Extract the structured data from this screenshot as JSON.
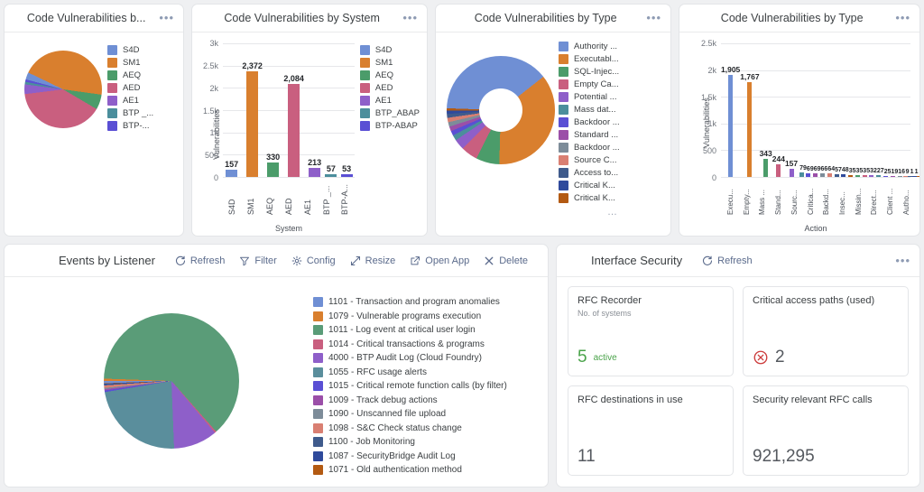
{
  "cards": {
    "c1": {
      "title": "Code Vulnerabilities b...",
      "kebab": "•••"
    },
    "c2": {
      "title": "Code Vulnerabilities by System",
      "kebab": "•••"
    },
    "c3": {
      "title": "Code Vulnerabilities by Type",
      "kebab": "•••",
      "more": "…"
    },
    "c4": {
      "title": "Code Vulnerabilities by Type",
      "kebab": "•••"
    },
    "events": {
      "title": "Events by Listener",
      "tools": [
        {
          "label": "Refresh",
          "icon": "refresh-icon"
        },
        {
          "label": "Filter",
          "icon": "filter-icon"
        },
        {
          "label": "Config",
          "icon": "gear-icon"
        },
        {
          "label": "Resize",
          "icon": "resize-icon"
        },
        {
          "label": "Open App",
          "icon": "open-app-icon"
        },
        {
          "label": "Delete",
          "icon": "close-icon"
        }
      ],
      "more": "…"
    },
    "interface_security": {
      "title": "Interface Security",
      "refresh_label": "Refresh",
      "kebab": "•••"
    }
  },
  "chart_data": [
    {
      "id": "code_vuln_by_system_pie",
      "type": "pie",
      "title": "Code Vulnerabilities b...",
      "categories": [
        "S4D",
        "SM1",
        "AEQ",
        "AED",
        "AE1",
        "BTP _...",
        "BTP-..."
      ],
      "values": [
        157,
        2372,
        330,
        2084,
        213,
        57,
        53
      ],
      "colors": [
        "#6f8fd4",
        "#d97f2e",
        "#4b9c6a",
        "#c95f7f",
        "#8e5fc9",
        "#4b8e9c",
        "#5a4fd4"
      ],
      "legend_labels": [
        "S4D",
        "SM1",
        "AEQ",
        "AED",
        "AE1",
        "BTP _...",
        "BTP-..."
      ],
      "legend_position": "right"
    },
    {
      "id": "code_vuln_by_system_bar",
      "type": "bar",
      "title": "Code Vulnerabilities by System",
      "xlabel": "System",
      "ylabel": "Vulnerabilities",
      "categories": [
        "S4D",
        "SM1",
        "AEQ",
        "AED",
        "AE1",
        "BTP _...",
        "BTP-A..."
      ],
      "values": [
        157,
        2372,
        330,
        2084,
        213,
        57,
        53
      ],
      "value_labels": [
        "157",
        "2,372",
        "330",
        "2,084",
        "213",
        "57",
        "53"
      ],
      "colors": [
        "#6f8fd4",
        "#d97f2e",
        "#4b9c6a",
        "#c95f7f",
        "#8e5fc9",
        "#4b8e9c",
        "#5a4fd4"
      ],
      "ylim": [
        0,
        3000
      ],
      "yticks": [
        0,
        500,
        1000,
        1500,
        2000,
        2500,
        3000
      ],
      "ytick_labels": [
        "0",
        "500",
        "1k",
        "1.5k",
        "2k",
        "2.5k",
        "3k"
      ],
      "grid": true,
      "legend_labels": [
        "S4D",
        "SM1",
        "AEQ",
        "AED",
        "AE1",
        "BTP_ABAP",
        "BTP-ABAP"
      ],
      "legend_position": "right"
    },
    {
      "id": "code_vuln_by_type_donut",
      "type": "pie",
      "title": "Code Vulnerabilities by Type",
      "categories": [
        "Authority ...",
        "Executabl...",
        "SQL-Injec...",
        "Empty Ca...",
        "Potential ...",
        "Mass dat...",
        "Backdoor ...",
        "Standard ...",
        "Backdoor ...",
        "Source C...",
        "Access to...",
        "Critical K...",
        "Critical K..."
      ],
      "values": [
        1905,
        1767,
        343,
        244,
        157,
        79,
        69,
        69,
        66,
        64,
        57,
        48,
        35
      ],
      "colors": [
        "#6f8fd4",
        "#d97f2e",
        "#4b9c6a",
        "#c95f7f",
        "#8e5fc9",
        "#4b8e9c",
        "#5a4fd4",
        "#9b4fa8",
        "#7d8c99",
        "#d97f72",
        "#3f5b8c",
        "#2f4a9c",
        "#b35a12"
      ],
      "legend_labels": [
        "Authority ...",
        "Executabl...",
        "SQL-Injec...",
        "Empty Ca...",
        "Potential ...",
        "Mass dat...",
        "Backdoor ...",
        "Standard ...",
        "Backdoor ...",
        "Source C...",
        "Access to...",
        "Critical K...",
        "Critical K..."
      ],
      "legend_position": "right"
    },
    {
      "id": "code_vuln_by_type_bar",
      "type": "bar",
      "title": "Code Vulnerabilities by Type",
      "xlabel": "Action",
      "ylabel": "Vulnerabilities",
      "categories": [
        "Execu...",
        "Empty...",
        "Mass ...",
        "Stand...",
        "Sourc...",
        "Critica...",
        "Backd...",
        "Insec...",
        "Missin...",
        "Direct...",
        "Client ...",
        "Autho..."
      ],
      "values": [
        1905,
        1767,
        343,
        244,
        157,
        79,
        69,
        69,
        66,
        64,
        57,
        48,
        35,
        35,
        35,
        32,
        27,
        25,
        19,
        16,
        9,
        1,
        1,
        1
      ],
      "value_labels": [
        "1,905",
        "1,767",
        "343",
        "244",
        "157",
        "79",
        "69",
        "69",
        "66",
        "64",
        "57",
        "48",
        "35",
        "35",
        "35",
        "32",
        "27",
        "25",
        "19",
        "16",
        "9",
        "1",
        "1",
        "1"
      ],
      "colors": [
        "#6f8fd4",
        "#d97f2e",
        "#4b9c6a",
        "#c95f7f",
        "#8e5fc9",
        "#4b8e9c",
        "#5a4fd4",
        "#9b4fa8",
        "#7d8c99",
        "#d97f72",
        "#3f5b8c",
        "#2f4a9c",
        "#b35a12",
        "#4b9c6a",
        "#c95f7f",
        "#8e5fc9",
        "#4b8e9c",
        "#5a4fd4",
        "#9b4fa8",
        "#7d8c99",
        "#d97f72",
        "#3f5b8c",
        "#2f4a9c",
        "#b35a12"
      ],
      "ylim": [
        0,
        2500
      ],
      "yticks": [
        0,
        500,
        1000,
        1500,
        2000,
        2500
      ],
      "ytick_labels": [
        "0",
        "500",
        "1k",
        "1.5k",
        "2k",
        "2.5k"
      ],
      "grid": true,
      "legend_position": "none"
    },
    {
      "id": "events_by_listener",
      "type": "pie",
      "title": "Events by Listener",
      "categories": [
        "1101 - Transaction and program anomalies",
        "1079 - Vulnerable programs execution",
        "1011 - Log event at critical user login",
        "1014 - Critical transactions & programs",
        "4000 - BTP Audit Log (Cloud Foundry)",
        "1055 - RFC usage alerts",
        "1015 - Critical remote function calls (by filter)",
        "1009 - Track debug actions",
        "1090 - Unscanned file upload",
        "1098 - S&C Check status change",
        "1100 - Job Monitoring",
        "1087 - SecurityBridge Audit Log",
        "1071 - Old authentication method"
      ],
      "values": [
        0.6,
        0.5,
        63.0,
        0.4,
        10.5,
        23.0,
        0.4,
        0.3,
        0.3,
        0.6,
        0.2,
        0.2,
        0.1
      ],
      "colors": [
        "#6f8fd4",
        "#d97f2e",
        "#5a9c78",
        "#c95f7f",
        "#8e5fc9",
        "#5a8e9c",
        "#5a4fd4",
        "#9b4fa8",
        "#7d8c99",
        "#d97f72",
        "#3f5b8c",
        "#2f4a9c",
        "#b35a12"
      ],
      "legend_labels": [
        "1101 - Transaction and program anomalies",
        "1079 - Vulnerable programs execution",
        "1011 - Log event at critical user login",
        "1014 - Critical transactions & programs",
        "4000 - BTP Audit Log (Cloud Foundry)",
        "1055 - RFC usage alerts",
        "1015 - Critical remote function calls (by filter)",
        "1009 - Track debug actions",
        "1090 - Unscanned file upload",
        "1098 - S&C Check status change",
        "1100 - Job Monitoring",
        "1087 - SecurityBridge Audit Log",
        "1071 - Old authentication method"
      ],
      "legend_position": "right"
    }
  ],
  "interface_security_tiles": [
    {
      "title": "RFC Recorder",
      "subtitle": "No. of systems",
      "value": "5",
      "suffix": "active",
      "status": "ok",
      "accent": "#4aa34a"
    },
    {
      "title": "Critical access paths (used)",
      "subtitle": "",
      "value": "2",
      "suffix": "",
      "status": "alert",
      "accent": "#cc3b3b"
    },
    {
      "title": "RFC destinations in use",
      "subtitle": "",
      "value": "11",
      "suffix": "",
      "status": "none",
      "accent": "#55595f"
    },
    {
      "title": "Security relevant RFC calls",
      "subtitle": "",
      "value": "921,295",
      "suffix": "",
      "status": "none",
      "accent": "#55595f"
    }
  ],
  "theme": {
    "background": "#eff0f2",
    "card_bg": "#ffffff",
    "border": "#e3e5e8",
    "title_color": "#3c4043",
    "tool_color": "#5b6b8c"
  }
}
